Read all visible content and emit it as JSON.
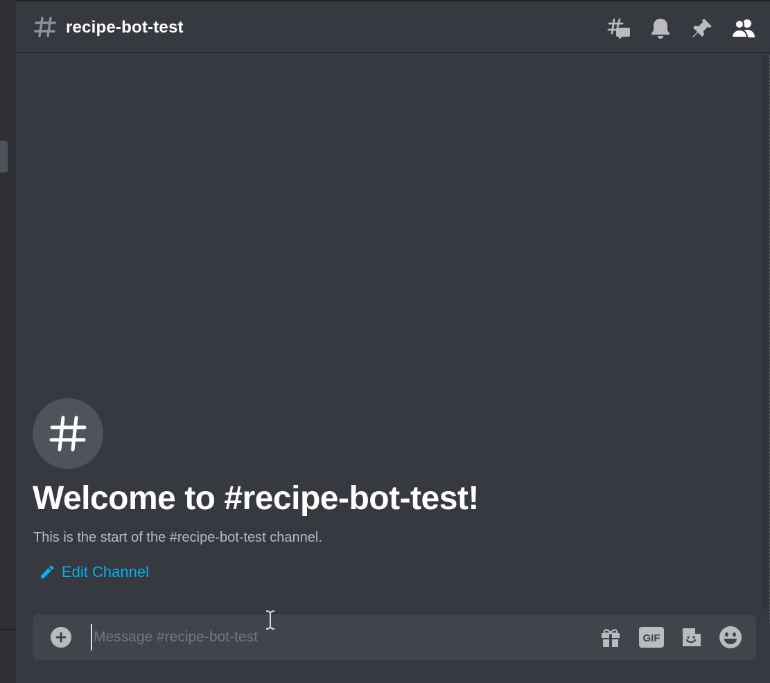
{
  "header": {
    "channel_name": "recipe-bot-test",
    "toolbar": [
      "threads-icon",
      "notification-bell-icon",
      "pin-icon",
      "member-list-icon"
    ]
  },
  "welcome": {
    "title": "Welcome to #recipe-bot-test!",
    "subtitle": "This is the start of the #recipe-bot-test channel.",
    "edit_label": "Edit Channel"
  },
  "composer": {
    "placeholder": "Message #recipe-bot-test",
    "value": "",
    "icons": [
      "gift-icon",
      "gif-icon",
      "sticker-icon",
      "emoji-icon"
    ]
  },
  "colors": {
    "background": "#36393f",
    "sidebar": "#2f3136",
    "composer": "#40444b",
    "link": "#00b0f4",
    "muted_text": "#b9bbbe",
    "icon": "#b9bbbe"
  }
}
